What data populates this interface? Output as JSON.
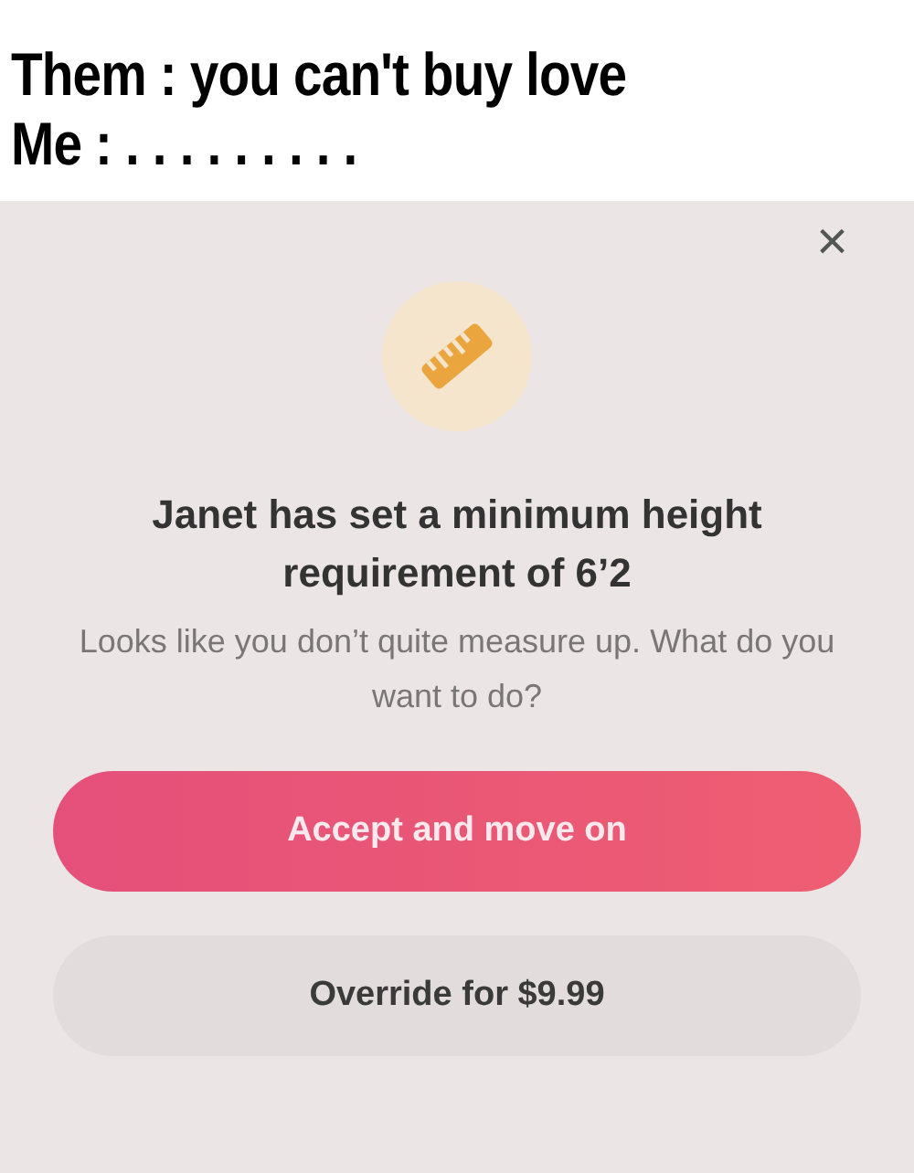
{
  "caption": {
    "lines": [
      "Them : you can't buy love",
      "Me : . . . . . . . . ."
    ]
  },
  "dialog": {
    "close": "×",
    "title": "Janet has set a minimum height requirement of 6’2",
    "message": "Looks like you don’t quite measure up. What do you want to do?",
    "buttons": [
      {
        "label": "Accept and move on",
        "kind": "primary"
      },
      {
        "label": "Override for $9.99",
        "kind": "secondary"
      }
    ]
  }
}
